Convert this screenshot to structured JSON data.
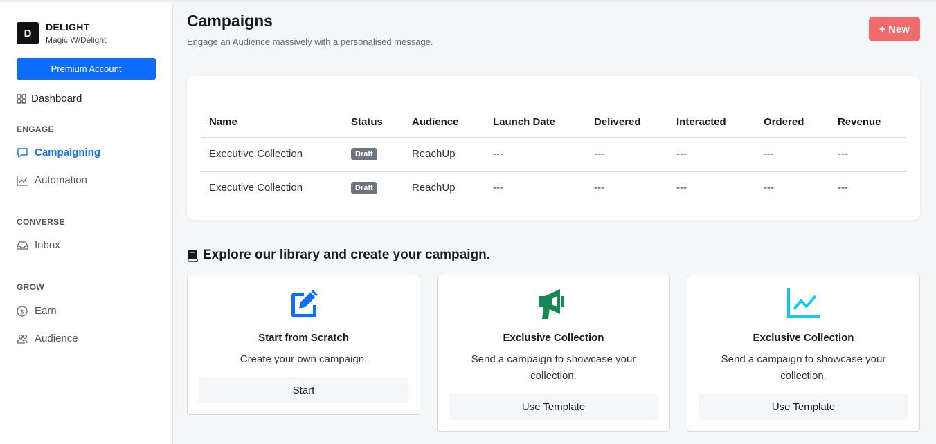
{
  "brand": {
    "logo_letter": "D",
    "name": "DELIGHT",
    "subtitle": "Magic W/Delight"
  },
  "sidebar": {
    "premium_label": "Premium Account",
    "dashboard_label": "Dashboard",
    "sections": {
      "engage": "ENGAGE",
      "converse": "CONVERSE",
      "grow": "GROW"
    },
    "items": {
      "campaigning": "Campaigning",
      "automation": "Automation",
      "inbox": "Inbox",
      "earn": "Earn",
      "audience": "Audience"
    },
    "active_color": "#1a73e8"
  },
  "header": {
    "title": "Campaigns",
    "subtitle": "Engage an Audience massively with a personalised message.",
    "new_button": "+ New",
    "new_button_color": "#f06b6b"
  },
  "table": {
    "columns": [
      "Name",
      "Status",
      "Audience",
      "Launch Date",
      "Delivered",
      "Interacted",
      "Ordered",
      "Revenue"
    ],
    "rows": [
      {
        "name": "Executive Collection",
        "status": "Draft",
        "audience": "ReachUp",
        "launch_date": "---",
        "delivered": "---",
        "interacted": "---",
        "ordered": "---",
        "revenue": "---"
      },
      {
        "name": "Executive Collection",
        "status": "Draft",
        "audience": "ReachUp",
        "launch_date": "---",
        "delivered": "---",
        "interacted": "---",
        "ordered": "---",
        "revenue": "---"
      }
    ]
  },
  "library": {
    "title": "Explore our library and create your campaign.",
    "cards": [
      {
        "icon": "edit-icon",
        "icon_color": "#0d6efd",
        "title": "Start from Scratch",
        "description": "Create your own campaign.",
        "button": "Start"
      },
      {
        "icon": "megaphone-icon",
        "icon_color": "#198754",
        "title": "Exclusive Collection",
        "description": "Send a campaign to showcase your collection.",
        "button": "Use Template"
      },
      {
        "icon": "chart-line-icon",
        "icon_color": "#0dcaf0",
        "title": "Exclusive Collection",
        "description": "Send a campaign to showcase your collection.",
        "button": "Use Template"
      }
    ]
  }
}
